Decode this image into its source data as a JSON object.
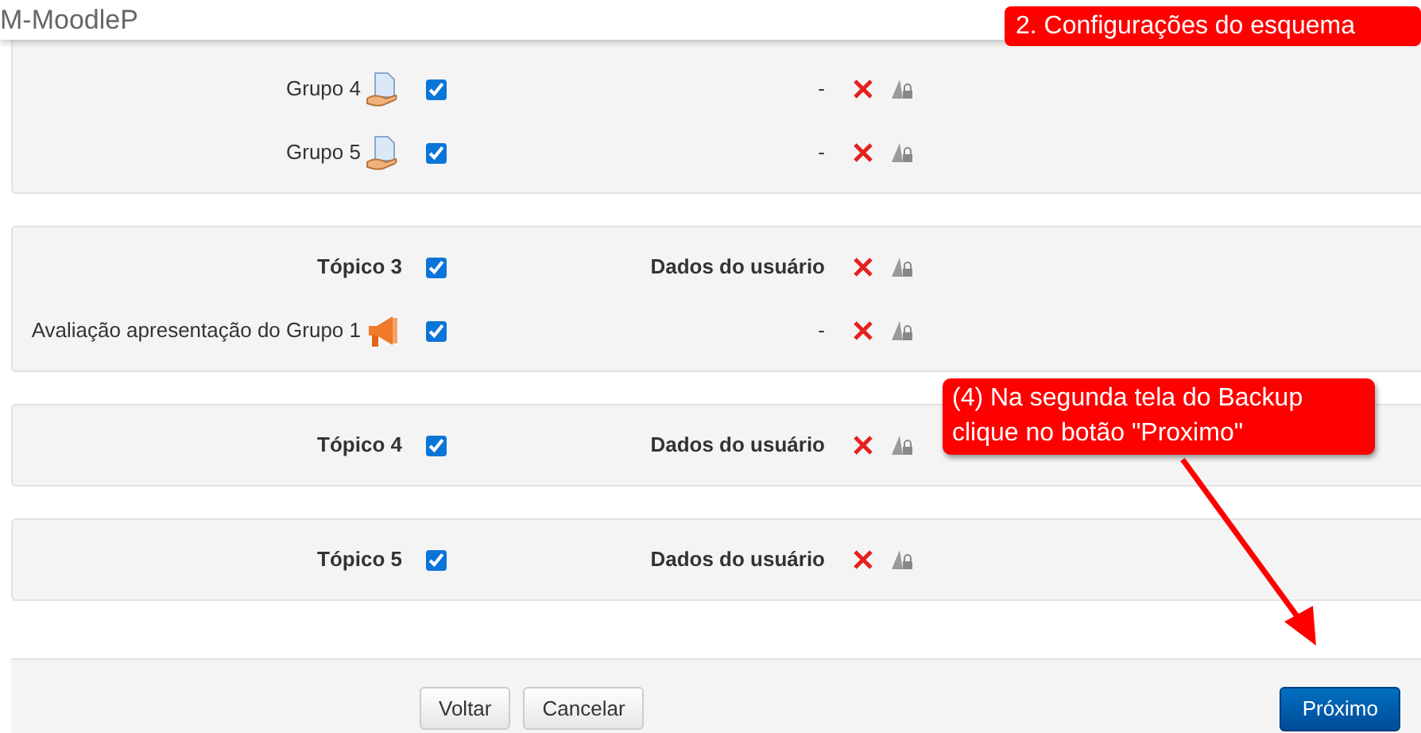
{
  "header": {
    "site_name": "M-MoodleP"
  },
  "sections": [
    {
      "rows": [
        {
          "kind": "assignment",
          "label": "Grupo 4",
          "included": true,
          "user_data": "-"
        },
        {
          "kind": "assignment",
          "label": "Grupo 5",
          "included": true,
          "user_data": "-"
        }
      ]
    },
    {
      "rows": [
        {
          "kind": "topic",
          "label": "Tópico 3",
          "included": true,
          "user_data": "Dados do usuário"
        },
        {
          "kind": "forum",
          "label": "Avaliação apresentação do Grupo 1",
          "included": true,
          "user_data": "-"
        }
      ]
    },
    {
      "rows": [
        {
          "kind": "topic",
          "label": "Tópico 4",
          "included": true,
          "user_data": "Dados do usuário"
        }
      ]
    },
    {
      "rows": [
        {
          "kind": "topic",
          "label": "Tópico 5",
          "included": true,
          "user_data": "Dados do usuário"
        }
      ]
    }
  ],
  "buttons": [
    {
      "label": "Voltar",
      "kind": "default"
    },
    {
      "label": "Cancelar",
      "kind": "default"
    },
    {
      "label": "Próximo",
      "kind": "primary"
    }
  ],
  "annotations": [
    {
      "kind": "heading",
      "text": "2. Configurações do esquema"
    },
    {
      "kind": "callout",
      "text": "(4) Na segunda tela do Backup clique no botão \"Proximo\""
    }
  ]
}
